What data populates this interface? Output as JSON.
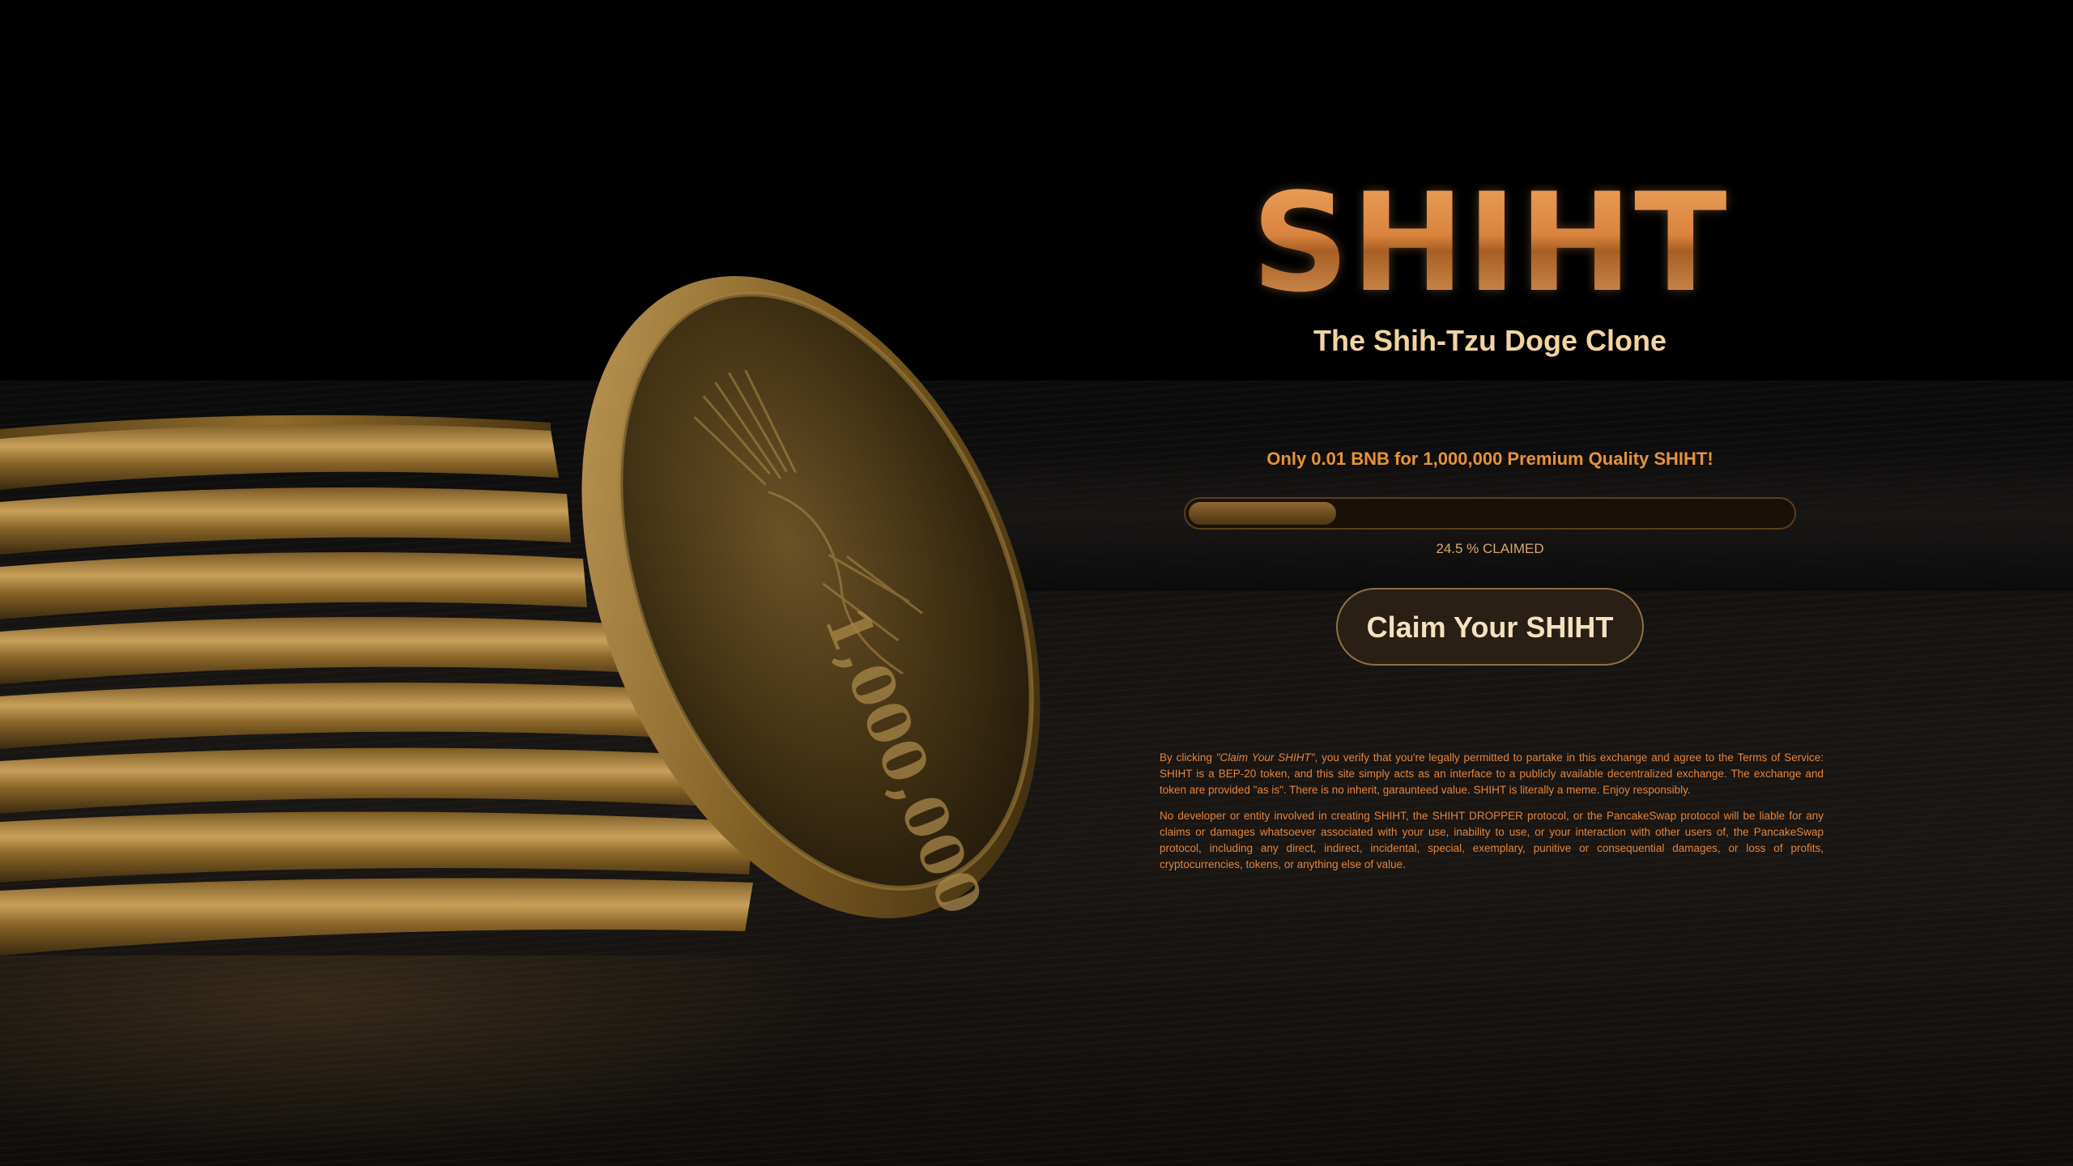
{
  "colors": {
    "accent": "#d9843e",
    "tagline": "#f1d4a0",
    "offer": "#e7923a",
    "disclaimer": "#e3853b",
    "button_bg": "#2a1f14",
    "button_border": "#8f7145"
  },
  "hero": {
    "title": "SHIHT",
    "tagline": "The Shih-Tzu Doge Clone",
    "offer": "Only 0.01 BNB for 1,000,000 Premium Quality SHIHT!"
  },
  "progress": {
    "percent": 24.5,
    "label": "24.5 % CLAIMED"
  },
  "claim_button": {
    "label": "Claim Your SHIHT"
  },
  "coin": {
    "engraving": "1,000,000"
  },
  "disclaimer": {
    "p1_prefix": "By clicking ",
    "p1_emphasis": "\"Claim Your SHIHT\"",
    "p1_suffix": ", you verify that you're legally permitted to partake in this exchange and agree to the Terms of Service: SHIHT is a BEP-20 token, and this site simply acts as an interface to a publicly available decentralized exchange. The exchange and token are provided \"as is\". There is no inherit, garaunteed value. SHIHT is literally a meme. Enjoy responsibly.",
    "p2": "No developer or entity involved in creating SHIHT, the SHIHT DROPPER protocol, or the PancakeSwap protocol will be liable for any claims or damages whatsoever associated with your use, inability to use, or your interaction with other users of, the PancakeSwap protocol, including any direct, indirect, incidental, special, exemplary, punitive or consequential damages, or loss of profits, cryptocurrencies, tokens, or anything else of value."
  }
}
